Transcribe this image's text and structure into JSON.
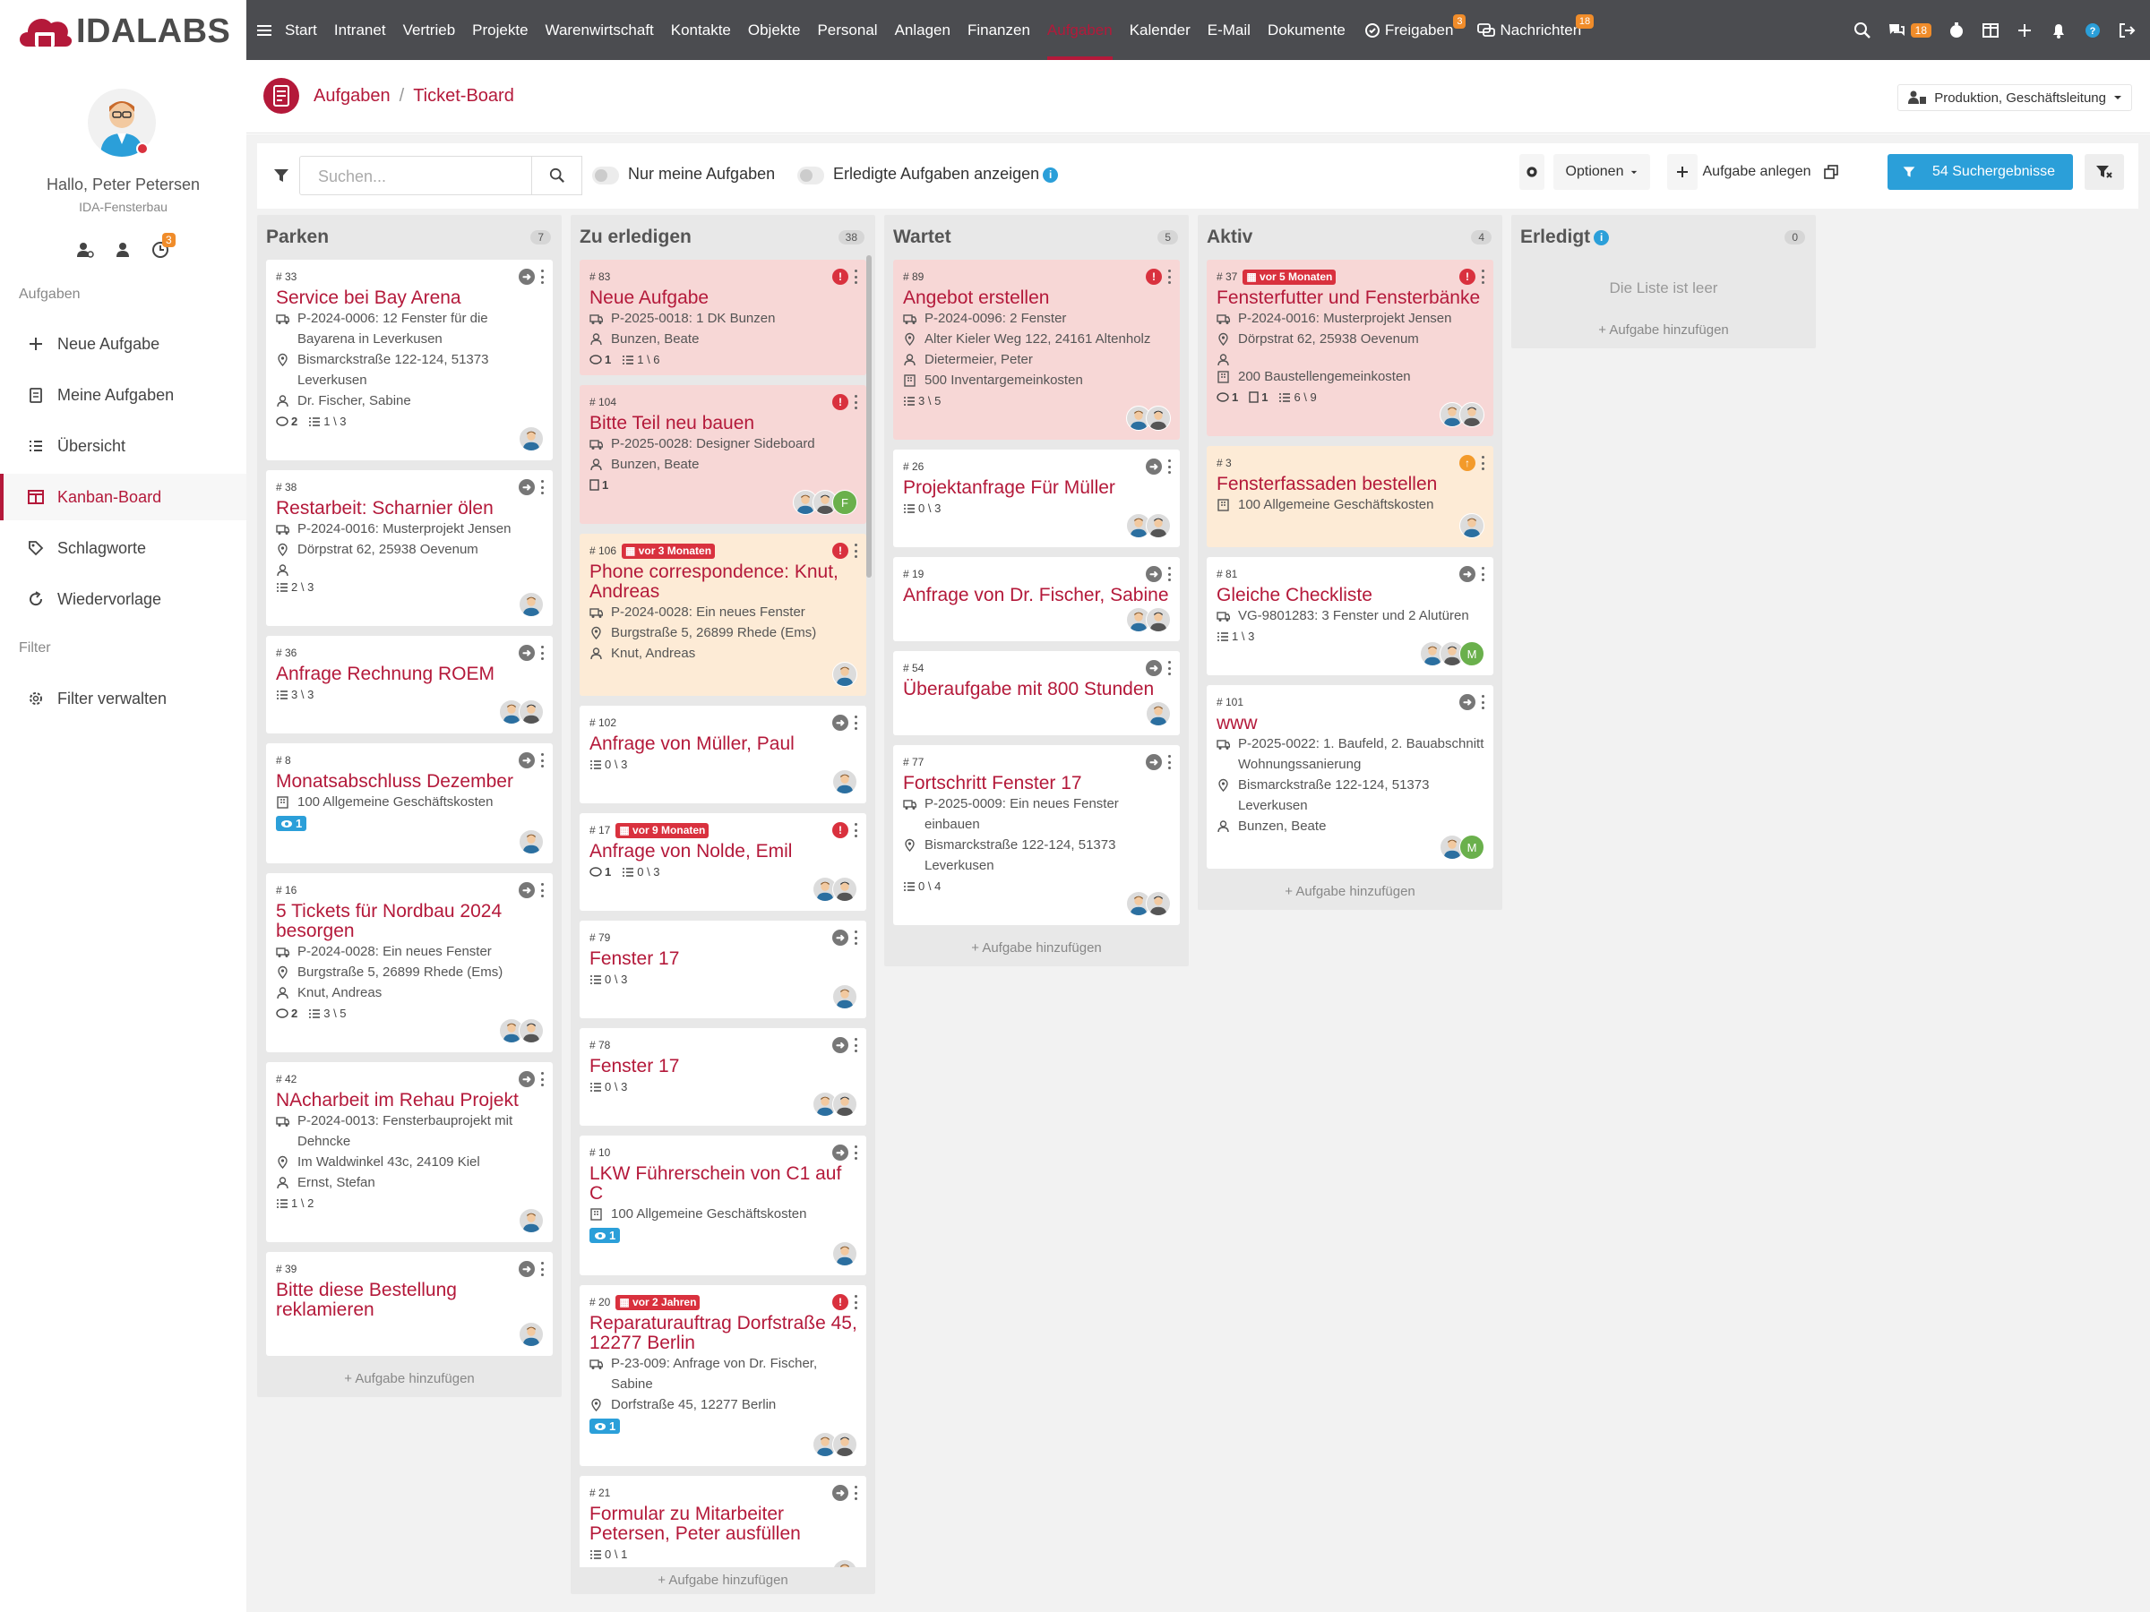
{
  "brand": {
    "logo_text": "IDALABS",
    "accent": "#b4193a",
    "nav_bg": "#4b4c50"
  },
  "sidebar": {
    "greeting": "Hallo, Peter Petersen",
    "company": "IDA-Fensterbau",
    "icons_badge": "3",
    "section_tasks": "Aufgaben",
    "items": [
      {
        "label": "Neue Aufgabe",
        "icon": "plus-icon"
      },
      {
        "label": "Meine Aufgaben",
        "icon": "clipboard-icon"
      },
      {
        "label": "Übersicht",
        "icon": "list-icon"
      },
      {
        "label": "Kanban-Board",
        "icon": "kanban-icon",
        "active": true
      },
      {
        "label": "Schlagworte",
        "icon": "tag-icon"
      },
      {
        "label": "Wiedervorlage",
        "icon": "refresh-icon"
      }
    ],
    "section_filter": "Filter",
    "filter_item": "Filter verwalten"
  },
  "topnav": {
    "items": [
      "Start",
      "Intranet",
      "Vertrieb",
      "Projekte",
      "Warenwirtschaft",
      "Kontakte",
      "Objekte",
      "Personal",
      "Anlagen",
      "Finanzen",
      "Aufgaben",
      "Kalender",
      "E-Mail",
      "Dokumente"
    ],
    "active": "Aufgaben",
    "freigaben": "Freigaben",
    "freigaben_badge": "3",
    "nachrichten": "Nachrichten",
    "nachrichten_badge": "18",
    "chat_badge": "18"
  },
  "header": {
    "crumb1": "Aufgaben",
    "sep": "/",
    "crumb2": "Ticket-Board",
    "department": "Produktion, Geschäftsleitung"
  },
  "toolbar": {
    "search_placeholder": "Suchen...",
    "my_tasks": "Nur meine Aufgaben",
    "done_tasks": "Erledigte Aufgaben anzeigen",
    "options": "Optionen",
    "create": "Aufgabe anlegen",
    "results": "54 Suchergebnisse"
  },
  "board": {
    "add_label": "Aufgabe hinzufügen",
    "empty_label": "Die Liste ist leer",
    "columns": [
      {
        "title": "Parken",
        "count": "7",
        "cards": [
          {
            "num": "# 33",
            "title": "Service bei Bay Arena",
            "lines": [
              {
                "i": "truck",
                "t": "P-2024-0006: 12 Fenster für die Bayarena in Leverkusen"
              },
              {
                "i": "pin",
                "t": "Bismarckstraße 122-124, 51373 Leverkusen"
              },
              {
                "i": "user",
                "t": "Dr. Fischer, Sabine"
              }
            ],
            "foot": {
              "comments": "2",
              "checks": "1 \\ 3"
            },
            "avs": 1,
            "state": "go"
          },
          {
            "num": "# 38",
            "title": "Restarbeit: Scharnier ölen",
            "lines": [
              {
                "i": "truck",
                "t": "P-2024-0016: Musterprojekt Jensen"
              },
              {
                "i": "pin",
                "t": "Dörpstrat 62, 25938 Oevenum"
              },
              {
                "i": "user",
                "t": ""
              }
            ],
            "foot": {
              "checks": "2 \\ 3"
            },
            "avs": 1,
            "state": "go"
          },
          {
            "num": "# 36",
            "title": "Anfrage Rechnung ROEM",
            "lines": [],
            "foot": {
              "checks": "3 \\ 3"
            },
            "avs": 2,
            "state": "go"
          },
          {
            "num": "# 8",
            "title": "Monatsabschluss Dezember",
            "lines": [
              {
                "i": "build",
                "t": "100 Allgemeine Geschäftskosten"
              }
            ],
            "foot": {
              "eye": "1"
            },
            "avs": 1,
            "state": "go"
          },
          {
            "num": "# 16",
            "title": "5 Tickets für Nordbau 2024 besorgen",
            "lines": [
              {
                "i": "truck",
                "t": "P-2024-0028: Ein neues Fenster"
              },
              {
                "i": "pin",
                "t": "Burgstraße 5, 26899 Rhede (Ems)"
              },
              {
                "i": "user",
                "t": "Knut, Andreas"
              }
            ],
            "foot": {
              "comments": "2",
              "checks": "3 \\ 5"
            },
            "avs": 2,
            "state": "go"
          },
          {
            "num": "# 42",
            "title": "NAcharbeit im Rehau Projekt",
            "lines": [
              {
                "i": "truck",
                "t": "P-2024-0013: Fensterbauprojekt mit Dehncke"
              },
              {
                "i": "pin",
                "t": "Im Waldwinkel 43c, 24109 Kiel"
              },
              {
                "i": "user",
                "t": "Ernst, Stefan"
              }
            ],
            "foot": {
              "checks": "1 \\ 2"
            },
            "avs": 1,
            "state": "go"
          },
          {
            "num": "# 39",
            "title": "Bitte diese Bestellung reklamieren",
            "lines": [],
            "foot": {},
            "avs": 1,
            "state": "go"
          }
        ]
      },
      {
        "title": "Zu erledigen",
        "count": "38",
        "cards": [
          {
            "num": "# 83",
            "title": "Neue Aufgabe",
            "color": "red",
            "lines": [
              {
                "i": "truck",
                "t": "P-2025-0018: 1 DK Bunzen"
              },
              {
                "i": "user",
                "t": "Bunzen, Beate"
              }
            ],
            "foot": {
              "comments": "1",
              "checks": "1 \\ 6"
            },
            "avs": 0,
            "state": "red"
          },
          {
            "num": "# 104",
            "title": "Bitte Teil neu bauen",
            "color": "red",
            "lines": [
              {
                "i": "truck",
                "t": "P-2025-0028: Designer Sideboard"
              },
              {
                "i": "user",
                "t": "Bunzen, Beate"
              }
            ],
            "foot": {
              "docs": "1"
            },
            "avs": 2,
            "green": "F",
            "state": "red"
          },
          {
            "num": "# 106",
            "due": "vor 3 Monaten",
            "title": "Phone correspondence: Knut, Andreas",
            "color": "peach",
            "lines": [
              {
                "i": "truck",
                "t": "P-2024-0028: Ein neues Fenster"
              },
              {
                "i": "pin",
                "t": "Burgstraße 5, 26899 Rhede (Ems)"
              },
              {
                "i": "user",
                "t": "Knut, Andreas"
              }
            ],
            "foot": {},
            "avs": 1,
            "state": "red"
          },
          {
            "num": "# 102",
            "title": "Anfrage von Müller, Paul",
            "lines": [],
            "foot": {
              "checks": "0 \\ 3"
            },
            "avs": 1,
            "state": "go"
          },
          {
            "num": "# 17",
            "due": "vor 9 Monaten",
            "title": "Anfrage von Nolde, Emil",
            "lines": [],
            "foot": {
              "comments": "1",
              "checks": "0 \\ 3"
            },
            "avs": 2,
            "state": "red"
          },
          {
            "num": "# 79",
            "title": "Fenster 17",
            "lines": [],
            "foot": {
              "checks": "0 \\ 3"
            },
            "avs": 1,
            "state": "go"
          },
          {
            "num": "# 78",
            "title": "Fenster 17",
            "lines": [],
            "foot": {
              "checks": "0 \\ 3"
            },
            "avs": 2,
            "state": "go"
          },
          {
            "num": "# 10",
            "title": "LKW Führerschein von C1 auf C",
            "lines": [
              {
                "i": "build",
                "t": "100 Allgemeine Geschäftskosten"
              }
            ],
            "foot": {
              "eye": "1"
            },
            "avs": 1,
            "state": "go"
          },
          {
            "num": "# 20",
            "due": "vor 2 Jahren",
            "title": "Reparaturauftrag Dorfstraße 45, 12277 Berlin",
            "lines": [
              {
                "i": "truck",
                "t": "P-23-009: Anfrage von Dr. Fischer, Sabine"
              },
              {
                "i": "pin",
                "t": "Dorfstraße 45, 12277 Berlin"
              }
            ],
            "foot": {
              "eye": "1"
            },
            "avs": 2,
            "state": "red"
          },
          {
            "num": "# 21",
            "title": "Formular zu Mitarbeiter Petersen, Peter ausfüllen",
            "lines": [],
            "foot": {
              "checks": "0 \\ 1"
            },
            "avs": 1,
            "state": "go"
          }
        ]
      },
      {
        "title": "Wartet",
        "count": "5",
        "cards": [
          {
            "num": "# 89",
            "title": "Angebot erstellen",
            "color": "red",
            "lines": [
              {
                "i": "truck",
                "t": "P-2024-0096: 2 Fenster"
              },
              {
                "i": "pin",
                "t": "Alter Kieler Weg 122, 24161 Altenholz"
              },
              {
                "i": "user",
                "t": "Dietermeier, Peter"
              },
              {
                "i": "build",
                "t": "500 Inventargemeinkosten"
              }
            ],
            "foot": {
              "checks": "3 \\ 5"
            },
            "avs": 2,
            "state": "red"
          },
          {
            "num": "# 26",
            "title": "Projektanfrage Für Müller",
            "lines": [],
            "foot": {
              "checks": "0 \\ 3"
            },
            "avs": 2,
            "state": "go"
          },
          {
            "num": "# 19",
            "title": "Anfrage von Dr. Fischer, Sabine",
            "lines": [],
            "foot": {},
            "avs": 2,
            "state": "go"
          },
          {
            "num": "# 54",
            "title": "Überaufgabe mit 800 Stunden",
            "lines": [],
            "foot": {},
            "avs": 1,
            "state": "go"
          },
          {
            "num": "# 77",
            "title": "Fortschritt Fenster 17",
            "lines": [
              {
                "i": "truck",
                "t": "P-2025-0009: Ein neues Fenster einbauen"
              },
              {
                "i": "pin",
                "t": "Bismarckstraße 122-124, 51373 Leverkusen"
              }
            ],
            "foot": {
              "checks": "0 \\ 4"
            },
            "avs": 2,
            "state": "go"
          }
        ]
      },
      {
        "title": "Aktiv",
        "count": "4",
        "cards": [
          {
            "num": "# 37",
            "due": "vor 5 Monaten",
            "title": "Fensterfutter und Fensterbänke",
            "color": "red",
            "lines": [
              {
                "i": "truck",
                "t": "P-2024-0016: Musterprojekt Jensen"
              },
              {
                "i": "pin",
                "t": "Dörpstrat 62, 25938 Oevenum"
              },
              {
                "i": "user",
                "t": ""
              },
              {
                "i": "build",
                "t": "200 Baustellengemeinkosten"
              }
            ],
            "foot": {
              "comments": "1",
              "docs": "1",
              "checks": "6 \\ 9"
            },
            "avs": 2,
            "state": "red"
          },
          {
            "num": "# 3",
            "title": "Fensterfassaden bestellen",
            "color": "peach",
            "lines": [
              {
                "i": "build",
                "t": "100 Allgemeine Geschäftskosten"
              }
            ],
            "foot": {},
            "avs": 1,
            "state": "org"
          },
          {
            "num": "# 81",
            "title": "Gleiche Checkliste",
            "lines": [
              {
                "i": "truck",
                "t": "VG-9801283: 3 Fenster und 2 Alutüren"
              }
            ],
            "foot": {
              "checks": "1 \\ 3"
            },
            "avs": 2,
            "green": "M",
            "state": "go"
          },
          {
            "num": "# 101",
            "title": "www",
            "lines": [
              {
                "i": "truck",
                "t": "P-2025-0022: 1. Baufeld, 2. Bauabschnitt Wohnungssanierung"
              },
              {
                "i": "pin",
                "t": "Bismarckstraße 122-124, 51373 Leverkusen"
              },
              {
                "i": "user",
                "t": "Bunzen, Beate"
              }
            ],
            "foot": {},
            "avs": 1,
            "green": "M",
            "state": "go"
          }
        ]
      },
      {
        "title": "Erledigt",
        "count": "0",
        "info": true,
        "cards": []
      }
    ]
  }
}
